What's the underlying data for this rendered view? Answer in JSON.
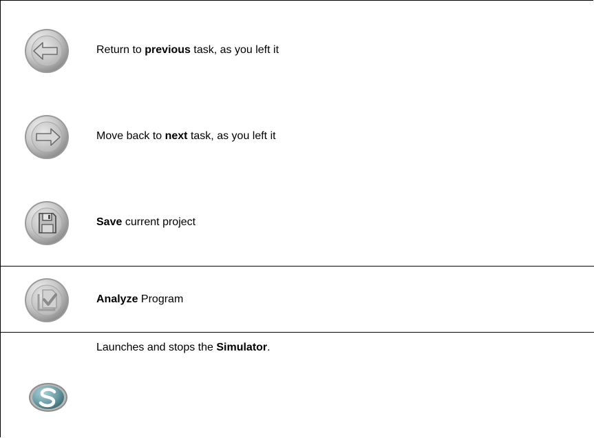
{
  "rows": [
    {
      "icon": "back-arrow-icon",
      "text_before": "Return to ",
      "text_bold": "previous",
      "text_after": " task, as you left it"
    },
    {
      "icon": "forward-arrow-icon",
      "text_before": "Move back to ",
      "text_bold": "next",
      "text_after": " task, as you left it"
    },
    {
      "icon": "floppy-disk-icon",
      "text_before": "",
      "text_bold": "Save",
      "text_after": " current project"
    },
    {
      "icon": "analyze-check-icon",
      "text_before": "",
      "text_bold": "Analyze",
      "text_after": " Program"
    },
    {
      "icon": "simulator-s-icon",
      "text_before": "Launches and stops the ",
      "text_bold": "Simulator",
      "text_after": "."
    }
  ],
  "colors": {
    "button_gray": "#c4c4c4",
    "button_dark": "#8f8f8f",
    "simulator_teal": "#5b8f9a",
    "border": "#000000"
  }
}
